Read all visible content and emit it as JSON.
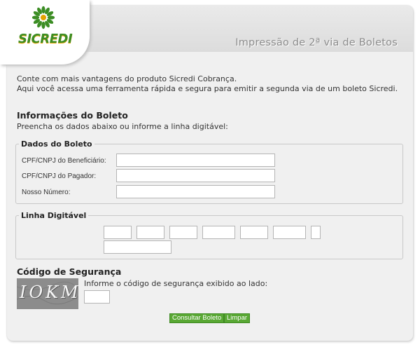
{
  "brand": {
    "logo_text": "SICREDI"
  },
  "header": {
    "title": "Impressão de 2ª via de Boletos"
  },
  "intro": {
    "line1": "Conte com mais vantagens do produto Sicredi Cobrança.",
    "line2": "Aqui você acessa uma ferramenta rápida e segura para emitir a segunda via de um boleto Sicredi."
  },
  "info": {
    "title": "Informações do Boleto",
    "subtitle": "Preencha os dados abaixo ou informe a linha digitável:"
  },
  "dados": {
    "legend": "Dados do Boleto",
    "fields": [
      {
        "label": "CPF/CNPJ do Beneficiário:",
        "value": ""
      },
      {
        "label": "CPF/CNPJ do Pagador:",
        "value": ""
      },
      {
        "label": "Nosso Número:",
        "value": ""
      }
    ]
  },
  "linha": {
    "legend": "Linha Digitável",
    "segments": [
      "",
      "",
      "",
      "",
      "",
      "",
      "",
      ""
    ]
  },
  "seguranca": {
    "title": "Código de Segurança",
    "captcha_text": "IOKM",
    "hint": "Informe o código de segurança exibido ao lado:",
    "value": ""
  },
  "buttons": {
    "consultar": "Consultar Boleto",
    "limpar": "Limpar"
  },
  "colors": {
    "brand_green": "#3c8d24",
    "brand_yellow": "#e3a200",
    "button_green": "#59a834"
  }
}
